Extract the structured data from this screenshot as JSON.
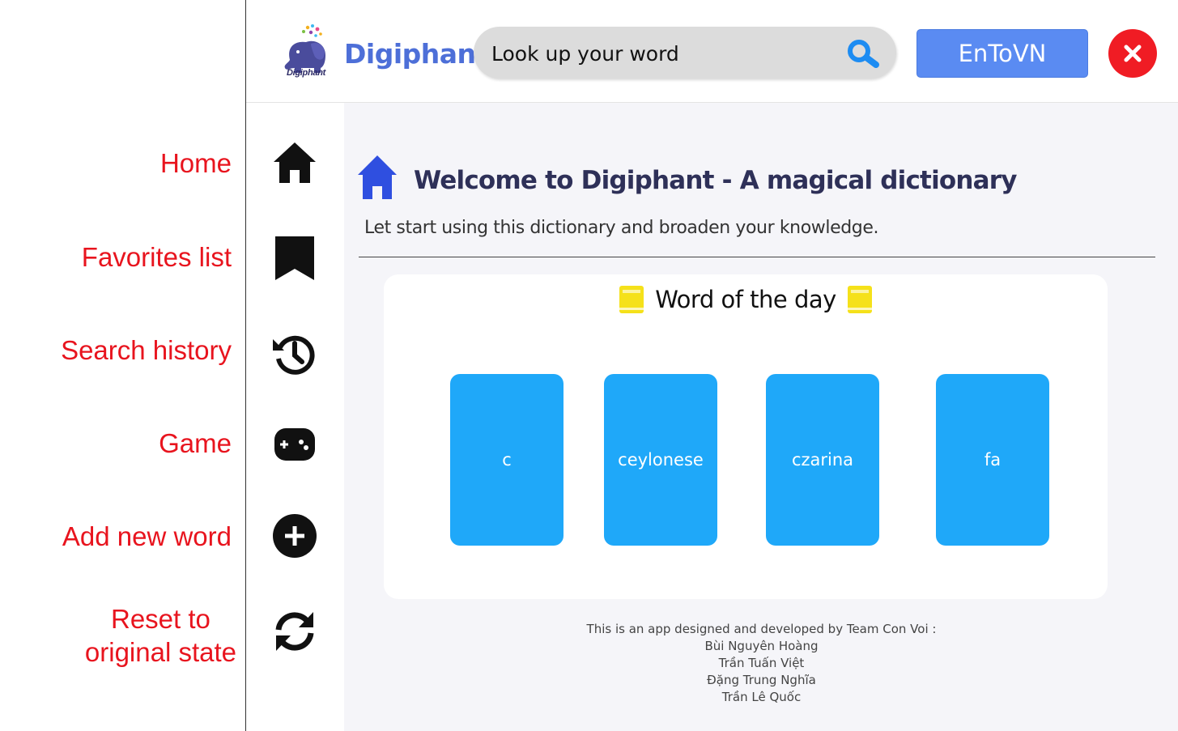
{
  "annotations": [
    {
      "key": "home",
      "text": "Home"
    },
    {
      "key": "favorites",
      "text": "Favorites list"
    },
    {
      "key": "history",
      "text": "Search history"
    },
    {
      "key": "game",
      "text": "Game"
    },
    {
      "key": "add",
      "text": "Add new word"
    },
    {
      "key": "reset",
      "text": "Reset to\noriginal state"
    }
  ],
  "header": {
    "logo_caption": "Digiphant",
    "brand": "Digiphant",
    "search_placeholder": "Look up your word",
    "search_icon": "magnifier-icon",
    "lang_button": "EnToVN",
    "close_icon": "close-icon"
  },
  "sidebar": {
    "items": [
      {
        "name": "home",
        "icon": "home-icon"
      },
      {
        "name": "favorites",
        "icon": "bookmark-icon"
      },
      {
        "name": "history",
        "icon": "history-icon"
      },
      {
        "name": "game",
        "icon": "gamepad-icon"
      },
      {
        "name": "add-word",
        "icon": "plus-circle-icon"
      },
      {
        "name": "reset",
        "icon": "refresh-icon"
      }
    ]
  },
  "main": {
    "welcome_title": "Welcome to Digiphant - A magical dictionary",
    "welcome_subtitle": "Let start using this dictionary and broaden your knowledge.",
    "word_of_day": {
      "title": "Word of the day",
      "words": [
        "c",
        "ceylonese",
        "czarina",
        "fa"
      ]
    },
    "footer": {
      "intro": "This is an app designed and developed by Team Con Voi :",
      "members": [
        "Bùi Nguyên Hoàng",
        "Trần Tuấn Việt",
        "Đặng Trung Nghĩa",
        "Trần Lê Quốc"
      ]
    }
  },
  "colors": {
    "annotation": "#e8141e",
    "brand": "#4d6fd8",
    "lang_button": "#5a8bf2",
    "close_button": "#f01c24",
    "word_card": "#1fa8f9",
    "home_icon": "#2f4fe0",
    "book_icon": "#f5e11a"
  }
}
